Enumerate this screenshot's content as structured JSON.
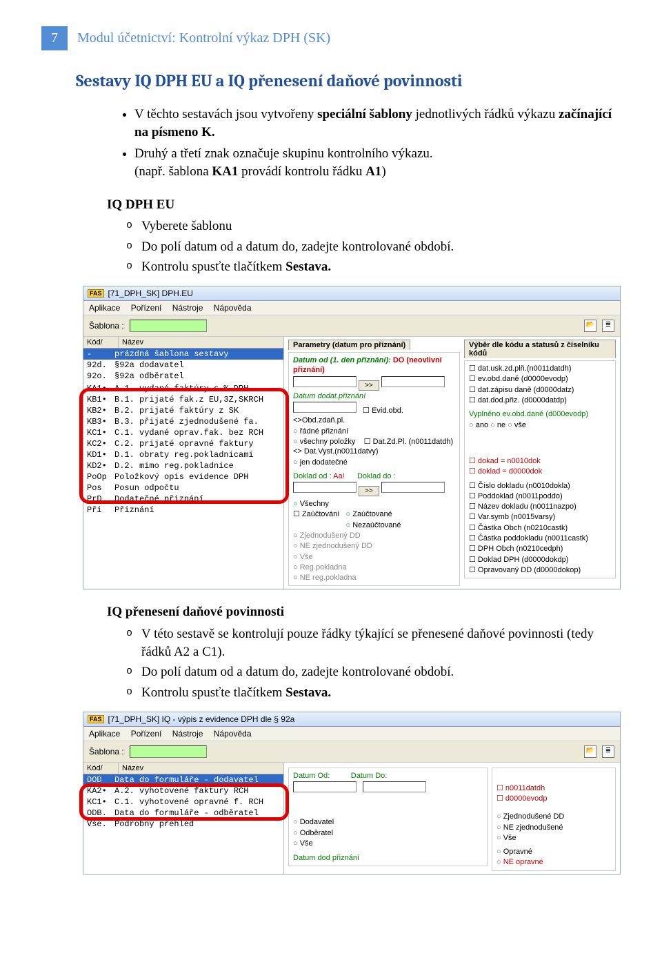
{
  "page_number": "7",
  "module_title": "Modul účetnictví: Kontrolní výkaz DPH (SK)",
  "section_title": "Sestavy IQ DPH EU a IQ přenesení daňové povinnosti",
  "para1_a": "V těchto sestavách jsou vytvořeny ",
  "para1_b": "speciální šablony",
  "para1_c": " jednotlivých řádků výkazu ",
  "para1_d": "začínající na písmeno K.",
  "para2_a": "Druhý a třetí znak označuje skupinu kontrolního výkazu.",
  "para2_b": "(např. šablona ",
  "para2_c": "KA1",
  "para2_d": " provádí kontrolu řádku ",
  "para2_e": "A1",
  "para2_f": ")",
  "h_iqdph": "IQ DPH EU",
  "iqdph_li1": "Vyberete šablonu",
  "iqdph_li2": "Do polí datum od a datum do, zadejte kontrolované období.",
  "iqdph_li3_a": "Kontrolu spusťte tlačítkem ",
  "iqdph_li3_b": "Sestava.",
  "h_iqpren": "IQ přenesení daňové povinnosti",
  "iqpren_li1": "V této sestavě se kontrolují pouze řádky týkající se přenesené daňové povinnosti (tedy řádků A2 a C1).",
  "iqpren_li2": "Do polí datum od a datum do, zadejte kontrolované období.",
  "iqpren_li3_a": "Kontrolu spusťte tlačítkem ",
  "iqpren_li3_b": "Sestava.",
  "mock1": {
    "title": "[71_DPH_SK] DPH.EU",
    "menu": [
      "Aplikace",
      "Pořízení",
      "Nástroje",
      "Nápověda"
    ],
    "sablona": "Šablona :",
    "left_hdr": [
      "Kód/",
      "Název"
    ],
    "rows": [
      [
        "-",
        "prázdná šablona sestavy",
        true
      ],
      [
        "92d.",
        "§92a dodavatel",
        false
      ],
      [
        "92o.",
        "§92a odběratel",
        false
      ],
      [
        "",
        "",
        false
      ],
      [
        "KA1•",
        "A.1. vydané faktúry s % DPH",
        false
      ],
      [
        "KB1•",
        "B.1. prijaté fak.z EU,3Z,SKRCH",
        false
      ],
      [
        "KB2•",
        "B.2. prijaté faktúry z SK",
        false
      ],
      [
        "KB3•",
        "B.3. přijaté zjednodušené fa.",
        false
      ],
      [
        "KC1•",
        "C.1. vydané oprav.fak. bez RCH",
        false
      ],
      [
        "KC2•",
        "C.2. prijaté opravné faktury",
        false
      ],
      [
        "KD1•",
        "D.1. obraty reg.pokladnicami",
        false
      ],
      [
        "KD2•",
        "D.2. mimo reg.pokladnice",
        false
      ],
      [
        "PoOp",
        "Položkový opis evidence DPH",
        false
      ],
      [
        "Pos",
        "Posun odpočtu",
        false
      ],
      [
        "PrD",
        "Dodatečné přiznání",
        false
      ],
      [
        "Při",
        "Přiznání",
        false
      ]
    ],
    "tab_params": "Parametry (datum pro přiznání)",
    "tab_kody": "Výběr dle kódu a statusů z číselníku kódů",
    "datum_od": "Datum od (1. den přiznání):",
    "do_note": "DO (neovlivní přiznání)",
    "go": ">>",
    "datum_dodat": "Datum dodat.přiznání",
    "rad": [
      "řádné přiznání",
      "všechny položky",
      "jen dodatečné"
    ],
    "evid": "Evid.obd.<>Obd.zdaň.pl.",
    "datzd": "Dat.Zd.Pl. (n0011datdh) <> Dat.Vyst.(n0011datvy)",
    "doklad_od": "Doklad od :",
    "aa": "Aa!",
    "doklad_do": "Doklad do :",
    "zauc_lbl": "Zaúčtování",
    "zauc": [
      "Všechny",
      "Zaúčtované",
      "Nezaúčtované"
    ],
    "zjed": [
      "Zjednodušený DD",
      "NE zjednodušený DD",
      "Vše"
    ],
    "regp": [
      "Reg.pokladna",
      "NE reg.pokladna",
      "Vše"
    ],
    "right_checks": [
      "dat.usk.zd.plň.(n0011datdh)",
      "ev.obd.daně (d0000evodp)",
      "dat.zápisu daně (d0000datz)",
      "dat.dod.přiz. (d0000datdp)"
    ],
    "vypl": "Vyplněno ev.obd.daně (d000evodp)",
    "vypl_opts": [
      "ano",
      "ne",
      "vše"
    ],
    "dok_checks": [
      "dokad = n0010dok",
      "doklad = d0000dok"
    ],
    "side_checks": [
      "Číslo dokladu (n0010dokla)",
      "Poddoklad (n0011poddo)",
      "Název dokladu (n0011nazpo)",
      "Var.symb (n0015varsy)",
      "Částka Obch (n0210castk)",
      "Částka poddokladu (n0011castk)",
      "DPH Obch (n0210cedph)",
      "Doklad DPH (d0000dokdp)",
      "Opravovaný DD (d0000dokop)"
    ]
  },
  "mock2": {
    "title": "[71_DPH_SK] IQ - výpis z evidence DPH dle § 92a",
    "menu": [
      "Aplikace",
      "Pořízení",
      "Nástroje",
      "Nápověda"
    ],
    "sablona": "Šablona :",
    "left_hdr": [
      "Kód/",
      "Název"
    ],
    "rows": [
      [
        "DOD",
        "Data do formuláře - dodavatel",
        true
      ],
      [
        "KA2•",
        "A.2. vyhotovené faktury RCH",
        false
      ],
      [
        "KC1•",
        "C.1. vyhotovené opravné f. RCH",
        false
      ],
      [
        "ODB.",
        "Data do formuláře - odběratel",
        false
      ],
      [
        "Vše.",
        "Podrobný přehled",
        false
      ]
    ],
    "datum_od": "Datum Od:",
    "datum_do": "Datum Do:",
    "side_checks": [
      "n0011datdh",
      "d0000evodp"
    ],
    "r1": [
      "Dodavatel",
      "Odběratel",
      "Vše"
    ],
    "r2": [
      "Zjednodušené DD",
      "NE zjednodušené",
      "Vše"
    ],
    "r3": [
      "Opravné",
      "NE opravné"
    ],
    "datum_dod": "Datum dod přiznání"
  }
}
